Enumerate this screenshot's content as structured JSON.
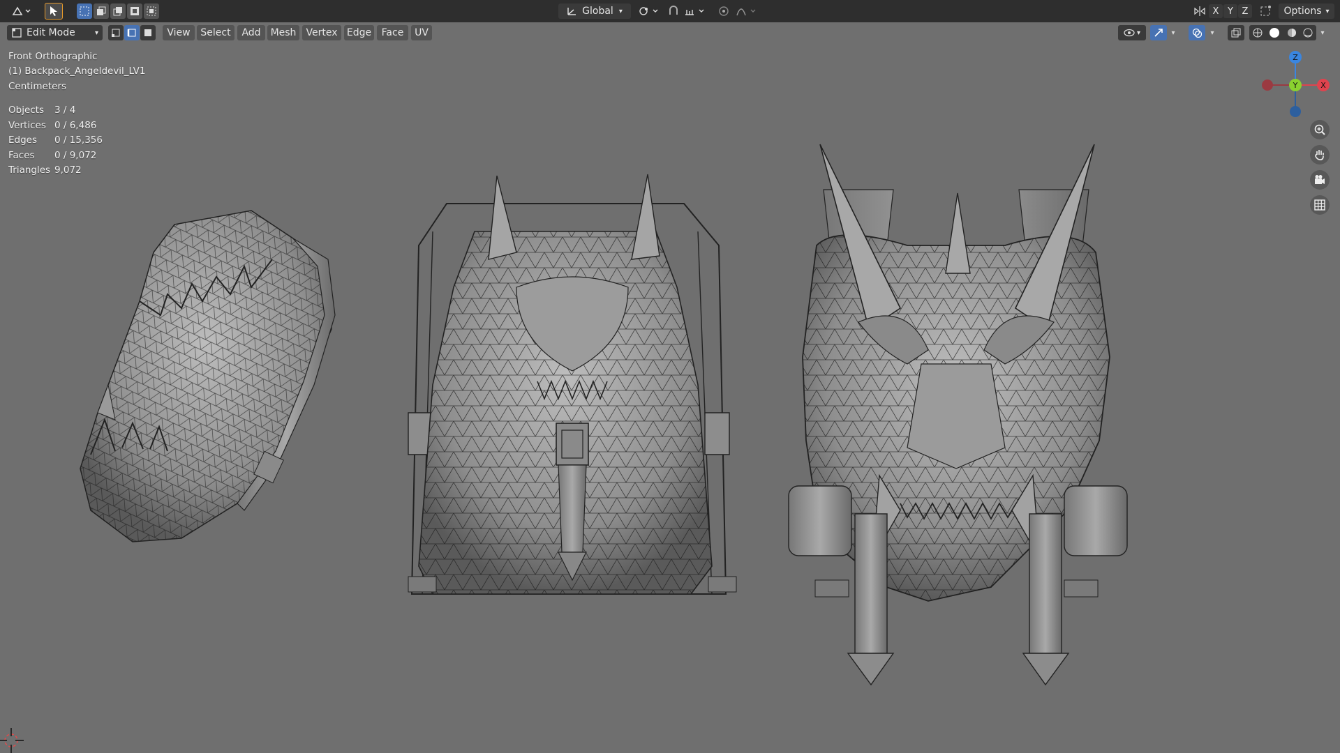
{
  "header": {
    "mode": "Edit Mode",
    "menus": [
      "View",
      "Select",
      "Add",
      "Mesh",
      "Vertex",
      "Edge",
      "Face",
      "UV"
    ],
    "transform_orientation": "Global",
    "options": "Options",
    "axes": [
      "X",
      "Y",
      "Z"
    ]
  },
  "overlay": {
    "view_name": "Front Orthographic",
    "object_name": "(1) Backpack_Angeldevil_LV1",
    "units": "Centimeters"
  },
  "stats": [
    {
      "label": "Objects",
      "value": "3 / 4"
    },
    {
      "label": "Vertices",
      "value": "0 / 6,486"
    },
    {
      "label": "Edges",
      "value": "0 / 15,356"
    },
    {
      "label": "Faces",
      "value": "0 / 9,072"
    },
    {
      "label": "Triangles",
      "value": "9,072"
    }
  ],
  "gizmo": {
    "x": "X",
    "y": "Y",
    "z": "Z",
    "x_color": "#e0434e",
    "y_color": "#8ad12f",
    "z_color": "#3a86e0"
  },
  "icons": [
    "editor-type-icon",
    "select-cursor-icon",
    "box-select-icon",
    "pivot-icon",
    "snap-icon",
    "proportional-edit-icon",
    "overlay-icon",
    "xray-icon",
    "shading-icon",
    "zoom-icon",
    "pan-hand-icon",
    "camera-icon",
    "grid-icon",
    "3d-cursor-icon"
  ]
}
